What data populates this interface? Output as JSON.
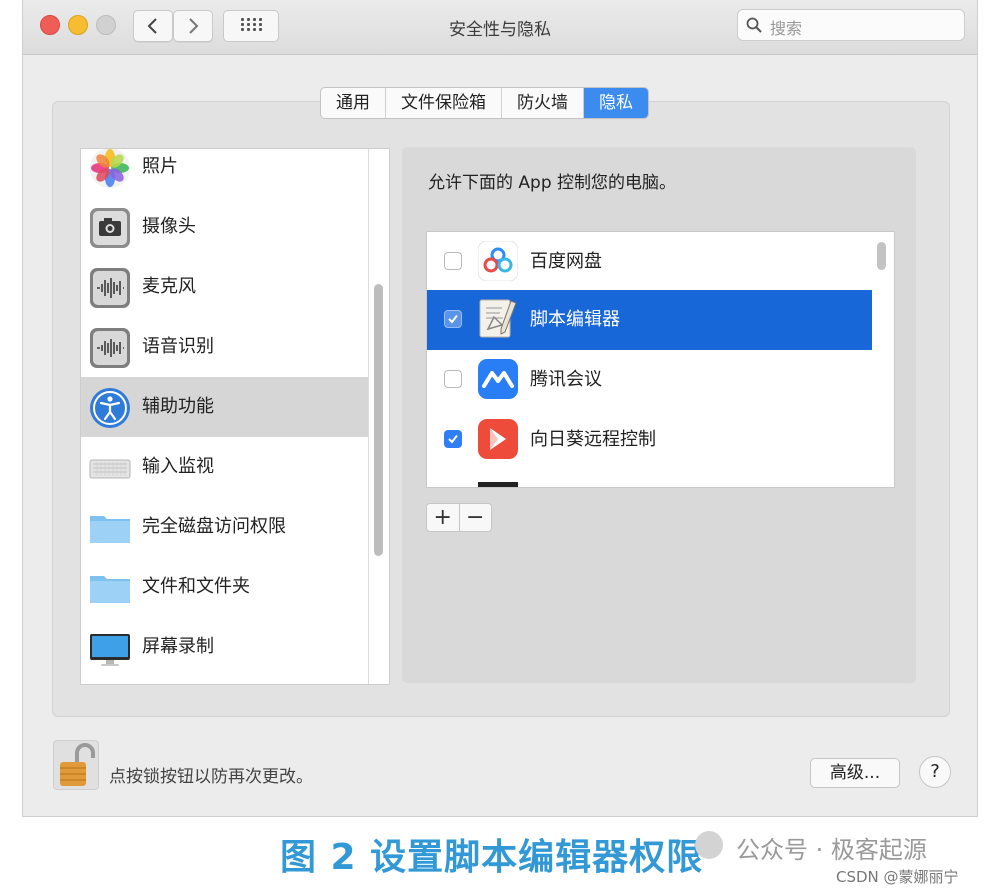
{
  "window": {
    "title": "安全性与隐私",
    "search_placeholder": "搜索"
  },
  "tabs": [
    {
      "label": "通用",
      "active": false
    },
    {
      "label": "文件保险箱",
      "active": false
    },
    {
      "label": "防火墙",
      "active": false
    },
    {
      "label": "隐私",
      "active": true
    }
  ],
  "sidebar": {
    "items": [
      {
        "label": "照片",
        "icon": "photos-icon",
        "selected": false
      },
      {
        "label": "摄像头",
        "icon": "camera-icon",
        "selected": false
      },
      {
        "label": "麦克风",
        "icon": "microphone-icon",
        "selected": false
      },
      {
        "label": "语音识别",
        "icon": "speech-recognition-icon",
        "selected": false
      },
      {
        "label": "辅助功能",
        "icon": "accessibility-icon",
        "selected": true
      },
      {
        "label": "输入监视",
        "icon": "keyboard-icon",
        "selected": false
      },
      {
        "label": "完全磁盘访问权限",
        "icon": "folder-icon",
        "selected": false
      },
      {
        "label": "文件和文件夹",
        "icon": "folder-icon",
        "selected": false
      },
      {
        "label": "屏幕录制",
        "icon": "display-icon",
        "selected": false
      }
    ]
  },
  "content": {
    "description": "允许下面的 App 控制您的电脑。",
    "apps": [
      {
        "name": "百度网盘",
        "checked": false,
        "selected": false,
        "icon": "baidu-netdisk-icon"
      },
      {
        "name": "脚本编辑器",
        "checked": true,
        "selected": true,
        "icon": "script-editor-icon"
      },
      {
        "name": "腾讯会议",
        "checked": false,
        "selected": false,
        "icon": "tencent-meeting-icon"
      },
      {
        "name": "向日葵远程控制",
        "checked": true,
        "selected": false,
        "icon": "sunlogin-icon"
      }
    ],
    "add_label": "+",
    "remove_label": "−"
  },
  "footer": {
    "lock_text": "点按锁按钮以防再次更改。",
    "advanced_label": "高级...",
    "help_label": "?"
  },
  "caption": "图 2  设置脚本编辑器权限",
  "watermark": "公众号 · 极客起源",
  "credit": "CSDN @蒙娜丽宁",
  "colors": {
    "accent": "#2f7ef5",
    "selection": "#1867d8",
    "caption": "#3399d6"
  }
}
